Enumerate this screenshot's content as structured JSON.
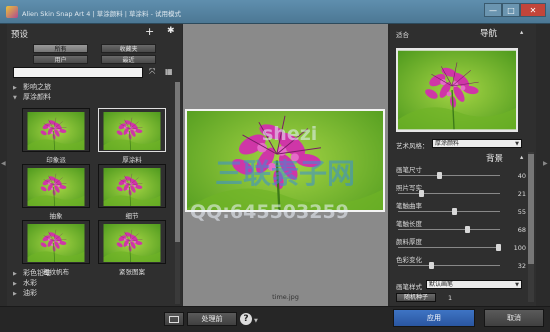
{
  "window": {
    "title": "Alien Skin Snap Art 4 | 草涂颜料 | 草涂料 - 试用模式",
    "minimize": "—",
    "maximize": "□",
    "close": "✕"
  },
  "left_panel": {
    "title": "预设",
    "add_icon": "plus-icon",
    "gear_icon": "gear-icon",
    "filters": {
      "all": "所有",
      "favorites": "收藏夹",
      "user": "用户",
      "recent": "最近"
    },
    "search": {
      "value": "",
      "placeholder": ""
    },
    "tree": [
      {
        "label": "影响之旅",
        "expanded": false
      },
      {
        "label": "厚涂颜料",
        "expanded": true
      }
    ],
    "presets": [
      {
        "label": "印象派",
        "selected": false
      },
      {
        "label": "厚涂料",
        "selected": true
      },
      {
        "label": "抽象",
        "selected": false
      },
      {
        "label": "细节",
        "selected": false
      },
      {
        "label": "粗纹帆布",
        "selected": false
      },
      {
        "label": "紧张图案",
        "selected": false
      }
    ],
    "tree_bottom": [
      {
        "label": "彩色铅笔"
      },
      {
        "label": "水彩"
      },
      {
        "label": "油彩"
      }
    ]
  },
  "center": {
    "filename": "time.jpg"
  },
  "watermark": {
    "line1": "shezi",
    "line2": "三联素子网",
    "line3": "QQ:645503259"
  },
  "right_panel": {
    "fit_label": "适合",
    "navigator_title": "导航",
    "art_style_label": "艺术风格：",
    "art_style_value": "厚涂颜料",
    "background_title": "背景",
    "params": [
      {
        "label": "画笔尺寸",
        "value": 40
      },
      {
        "label": "照片写实",
        "value": 21
      },
      {
        "label": "笔触曲率",
        "value": 55
      },
      {
        "label": "笔触长度",
        "value": 68
      },
      {
        "label": "颜料厚度",
        "value": 100
      },
      {
        "label": "色彩变化",
        "value": 32
      }
    ],
    "brush_style_label": "画笔样式",
    "brush_style_value": "默认画笔",
    "seed_button": "随机种子",
    "seed_value": "1"
  },
  "bottom_bar": {
    "process_button": "处理前",
    "help_icon": "help-icon",
    "apply_button": "应用",
    "cancel_button": "取消"
  },
  "colors": {
    "accent": "#2f61b5",
    "panel": "#2f2f2f",
    "titlebar": "#5a89a8",
    "flower_pink": "#c42e9f",
    "leaf_green": "#7cbd2e"
  }
}
